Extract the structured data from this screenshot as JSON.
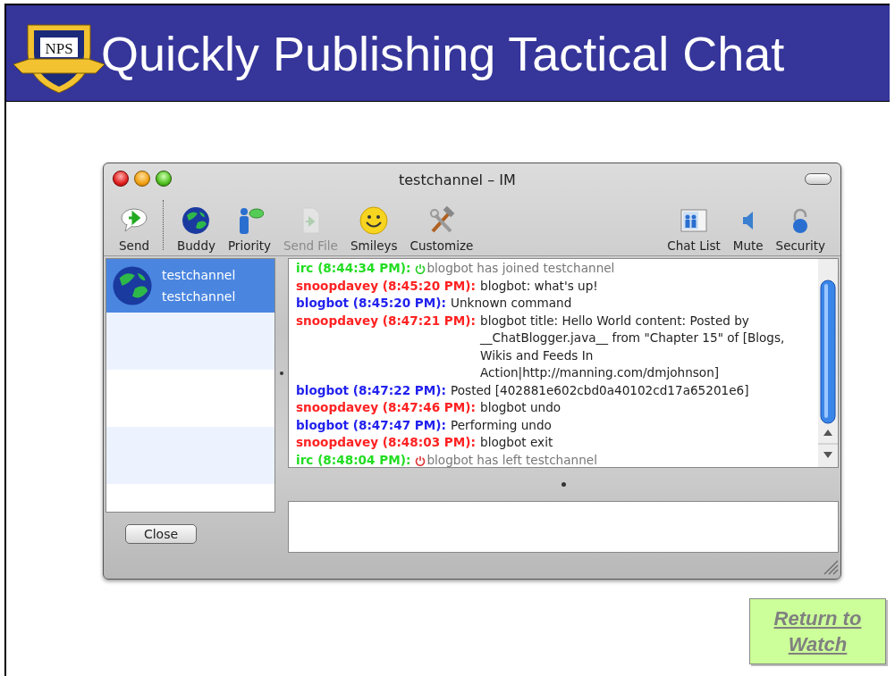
{
  "slide": {
    "title": "Quickly Publishing Tactical Chat",
    "logo_text": "NPS"
  },
  "window": {
    "title": "testchannel – IM"
  },
  "toolbar": {
    "left": [
      {
        "kind": "button",
        "label": "Send",
        "disabled": false
      },
      {
        "kind": "separator"
      },
      {
        "kind": "button",
        "label": "Buddy",
        "disabled": false
      },
      {
        "kind": "button",
        "label": "Priority",
        "disabled": false
      },
      {
        "kind": "button",
        "label": "Send File",
        "disabled": true
      },
      {
        "kind": "button",
        "label": "Smileys",
        "disabled": false
      },
      {
        "kind": "button",
        "label": "Customize",
        "disabled": false
      }
    ],
    "right": [
      {
        "kind": "button",
        "label": "Chat List",
        "disabled": false
      },
      {
        "kind": "button",
        "label": "Mute",
        "disabled": false
      },
      {
        "kind": "button",
        "label": "Security",
        "disabled": false
      }
    ]
  },
  "buddy_list": [
    {
      "name": "testchannel",
      "status": "testchannel",
      "selected": true
    }
  ],
  "messages": [
    {
      "kind": "join",
      "from": "irc (8:44:34 PM):",
      "color": "#22dd22",
      "text": "blogbot has joined testchannel"
    },
    {
      "kind": "message",
      "from": "snoopdavey (8:45:20 PM):",
      "color": "#ff2222",
      "text": "blogbot: what's up!"
    },
    {
      "kind": "message",
      "from": "blogbot (8:45:20 PM):",
      "color": "#2222ee",
      "text": "Unknown command"
    },
    {
      "kind": "message",
      "from": "snoopdavey (8:47:21 PM):",
      "color": "#ff2222",
      "text": "blogbot title: Hello World content: Posted by __ChatBlogger.java__ from \"Chapter 15\" of [Blogs, Wikis and Feeds In Action|http://manning.com/dmjohnson]"
    },
    {
      "kind": "message",
      "from": "blogbot (8:47:22 PM):",
      "color": "#2222ee",
      "text": "Posted [402881e602cbd0a40102cd17a65201e6]"
    },
    {
      "kind": "message",
      "from": "snoopdavey (8:47:46 PM):",
      "color": "#ff2222",
      "text": "blogbot undo"
    },
    {
      "kind": "message",
      "from": "blogbot (8:47:47 PM):",
      "color": "#2222ee",
      "text": "Performing undo"
    },
    {
      "kind": "message",
      "from": "snoopdavey (8:48:03 PM):",
      "color": "#ff2222",
      "text": "blogbot exit"
    },
    {
      "kind": "leave",
      "from": "irc (8:48:04 PM):",
      "color": "#22dd22",
      "text": "blogbot has left testchannel"
    }
  ],
  "close_button": "Close",
  "return_link": "Return to Watch"
}
